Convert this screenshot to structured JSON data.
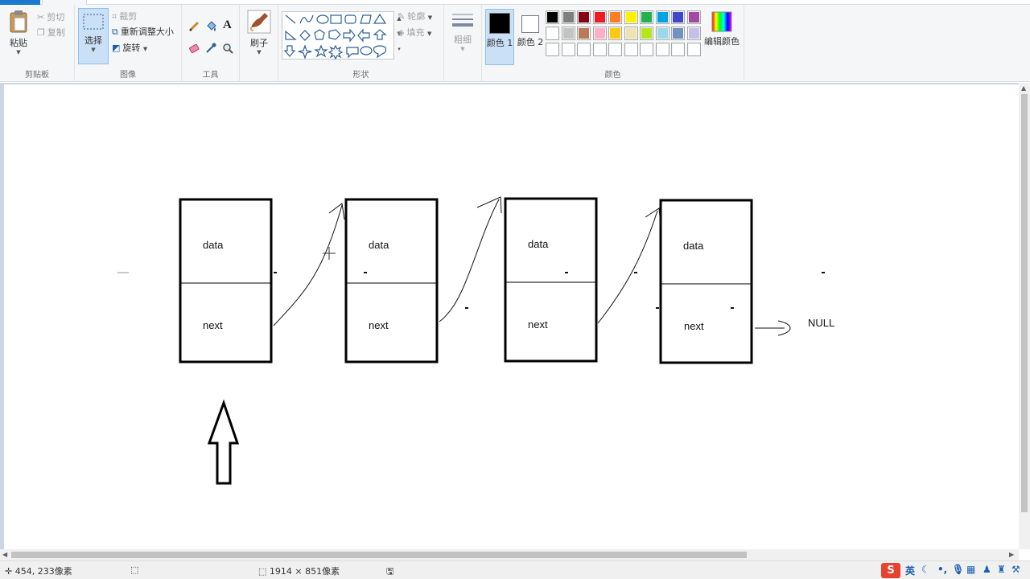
{
  "ribbon": {
    "clipboard": {
      "label": "剪贴板",
      "paste": "粘贴",
      "cut": "剪切",
      "copy": "复制"
    },
    "image": {
      "label": "图像",
      "select": "选择",
      "crop": "裁剪",
      "resize": "重新调整大小",
      "rotate": "旋转"
    },
    "tools": {
      "label": "工具",
      "text_glyph": "A"
    },
    "brushes": {
      "label": "刷子"
    },
    "shapes": {
      "label": "形状",
      "outline": "轮廓",
      "fill": "填充"
    },
    "size": {
      "label": "粗细"
    },
    "colors": {
      "label": "颜色",
      "color1": "颜色 1",
      "color2": "颜色 2",
      "edit": "编辑颜色",
      "color1_value": "#000000",
      "color2_value": "#ffffff",
      "palette_row1": [
        "#000000",
        "#7f7f7f",
        "#880015",
        "#ed1c24",
        "#ff7f27",
        "#fff200",
        "#22b14c",
        "#00a2e8",
        "#3f48cc",
        "#a349a4"
      ],
      "palette_row2": [
        "#ffffff",
        "#c3c3c3",
        "#b97a57",
        "#ffaec9",
        "#ffc90e",
        "#efe4b0",
        "#b5e61d",
        "#99d9ea",
        "#7092be",
        "#c8bfe7"
      ],
      "palette_row3": [
        "#ffffff",
        "#ffffff",
        "#ffffff",
        "#ffffff",
        "#ffffff",
        "#ffffff",
        "#ffffff",
        "#ffffff",
        "#ffffff",
        "#ffffff"
      ]
    }
  },
  "canvas": {
    "nodes": [
      {
        "data": "data",
        "next": "next"
      },
      {
        "data": "data",
        "next": "next"
      },
      {
        "data": "data",
        "next": "next"
      },
      {
        "data": "data",
        "next": "next"
      }
    ],
    "null_label": "NULL"
  },
  "status": {
    "cursor_pos": "454, 233像素",
    "canvas_size": "1914 × 851像素"
  },
  "ime": {
    "mode": "英"
  }
}
